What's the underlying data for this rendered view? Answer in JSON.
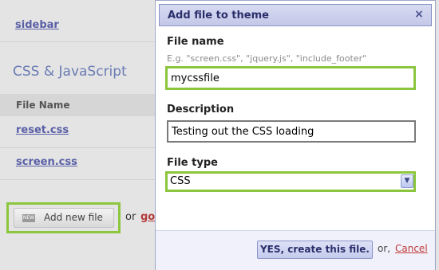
{
  "background": {
    "sidebar_link": "sidebar",
    "section_title": "CSS & JavaScript",
    "table_header": "File Name",
    "files": [
      "reset.css",
      "screen.css"
    ],
    "add_button_badge": "NEW",
    "add_button_label": "Add new file",
    "or_text": "or",
    "go_link": "go"
  },
  "modal": {
    "title": "Add file to theme",
    "close_icon": "×",
    "file_name": {
      "label": "File name",
      "hint": "E.g. \"screen.css\", \"jquery.js\", \"include_footer\"",
      "value": "mycssfile"
    },
    "description": {
      "label": "Description",
      "value": "Testing out the CSS loading"
    },
    "file_type": {
      "label": "File type",
      "selected": "CSS"
    },
    "footer": {
      "create_label": "YES, create this file.",
      "or_text": "or,",
      "cancel_label": "Cancel"
    }
  },
  "colors": {
    "highlight": "#8cc63f",
    "modal_header": "#c4c8e8",
    "link": "#5a5fa6",
    "cancel": "#c23a3a"
  }
}
